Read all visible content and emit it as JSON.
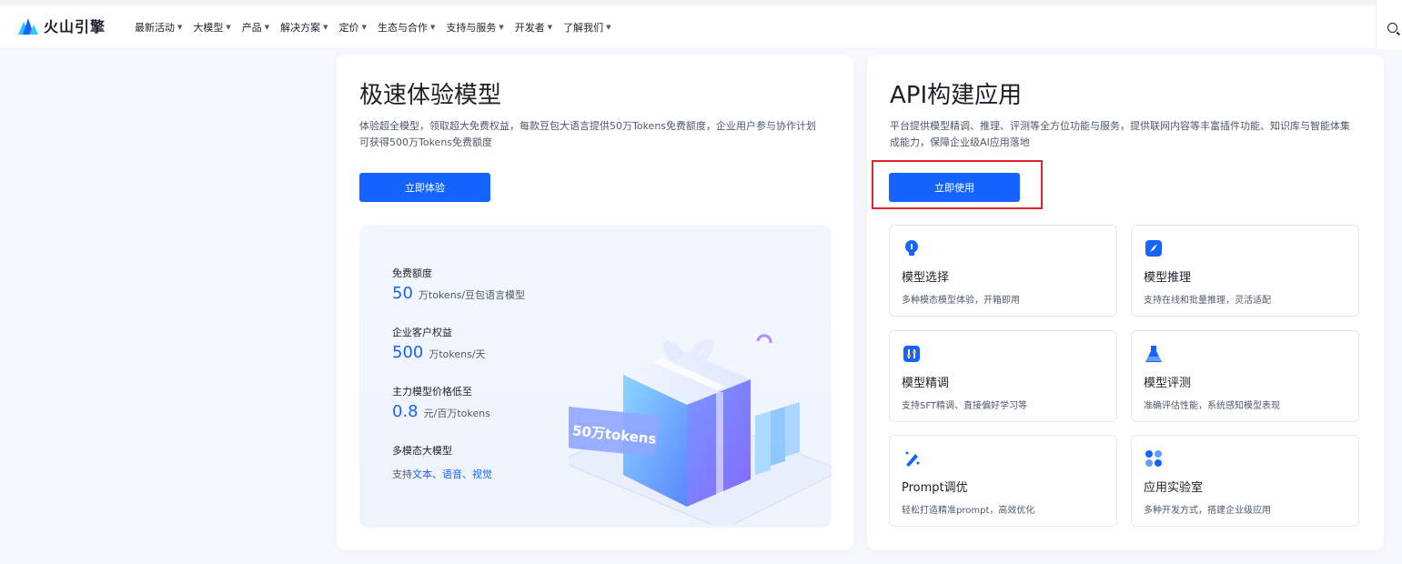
{
  "brand": {
    "name": "火山引擎"
  },
  "nav": {
    "items": [
      "最新活动",
      "大模型",
      "产品",
      "解决方案",
      "定价",
      "生态与合作",
      "支持与服务",
      "开发者",
      "了解我们"
    ]
  },
  "left_card": {
    "title": "极速体验模型",
    "desc_line1": "体验超全模型，领取超大免费权益，每款豆包大语言提供50万Tokens免费额度，企业用户参与协作计划",
    "desc_line2": "可获得500万Tokens免费额度",
    "button": "立即体验",
    "promo": {
      "free_quota_label": "免费额度",
      "free_quota_value": "50",
      "free_quota_unit": "万tokens/豆包语言模型",
      "enterprise_label": "企业客户权益",
      "enterprise_value": "500",
      "enterprise_unit": "万tokens/天",
      "price_label": "主力模型价格低至",
      "price_value": "0.8",
      "price_unit": "元/百万tokens",
      "multimodal_label": "多模态大模型",
      "multimodal_prefix": "支持",
      "multimodal_items": "文本、语音、视觉",
      "gift_banner": "50万tokens"
    }
  },
  "right_card": {
    "title": "API构建应用",
    "desc_line1": "平台提供模型精调、推理、评测等全方位功能与服务，提供联网内容等丰富插件功能、知识库与智能体集",
    "desc_line2": "成能力，保障企业级AI应用落地",
    "button": "立即使用",
    "features": [
      {
        "title": "模型选择",
        "desc": "多种模态模型体验，开箱即用",
        "icon": "lightbulb-icon"
      },
      {
        "title": "模型推理",
        "desc": "支持在线和批量推理，灵活适配",
        "icon": "rocket-icon"
      },
      {
        "title": "模型精调",
        "desc": "支持SFT精调、直接偏好学习等",
        "icon": "tuning-icon"
      },
      {
        "title": "模型评测",
        "desc": "准确评估性能，系统感知模型表现",
        "icon": "flask-icon"
      },
      {
        "title": "Prompt调优",
        "desc": "轻松打造精准prompt，高效优化",
        "icon": "magic-pen-icon"
      },
      {
        "title": "应用实验室",
        "desc": "多种开发方式，搭建企业级应用",
        "icon": "apps-icon"
      }
    ]
  },
  "colors": {
    "primary": "#1664ff",
    "highlight": "#e0262d"
  }
}
